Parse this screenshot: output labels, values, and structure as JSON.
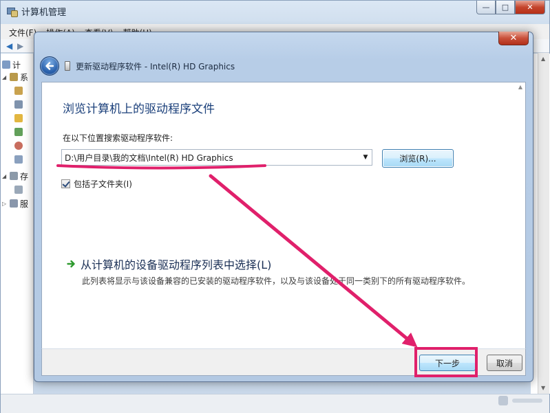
{
  "background_window": {
    "title": "计算机管理",
    "menu": [
      "文件(F)",
      "操作(A)",
      "查看(V)",
      "帮助(H)"
    ],
    "tree_items": [
      "计",
      "系",
      "存",
      "服"
    ],
    "caption_min": "—",
    "caption_max": "□",
    "caption_close": "✕"
  },
  "dialog": {
    "close_glyph": "✕",
    "title": "更新驱动程序软件 - Intel(R) HD Graphics",
    "heading": "浏览计算机上的驱动程序文件",
    "search_label": "在以下位置搜索驱动程序软件:",
    "path_value": "D:\\用户目录\\我的文档\\Intel(R) HD Graphics",
    "browse_label": "浏览(R)...",
    "include_subfolders_label": "包括子文件夹(I)",
    "include_subfolders_checked": true,
    "pick_link": "从计算机的设备驱动程序列表中选择(L)",
    "pick_description": "此列表将显示与该设备兼容的已安装的驱动程序软件，以及与该设备处于同一类别下的所有驱动程序软件。",
    "next_label": "下一步",
    "cancel_label": "取消"
  },
  "annotation_color": "#e0206b",
  "icons": {
    "back": "back-arrow-icon",
    "device": "device-icon",
    "link": "green-arrow-icon",
    "dropdown": "chevron-down-icon"
  }
}
